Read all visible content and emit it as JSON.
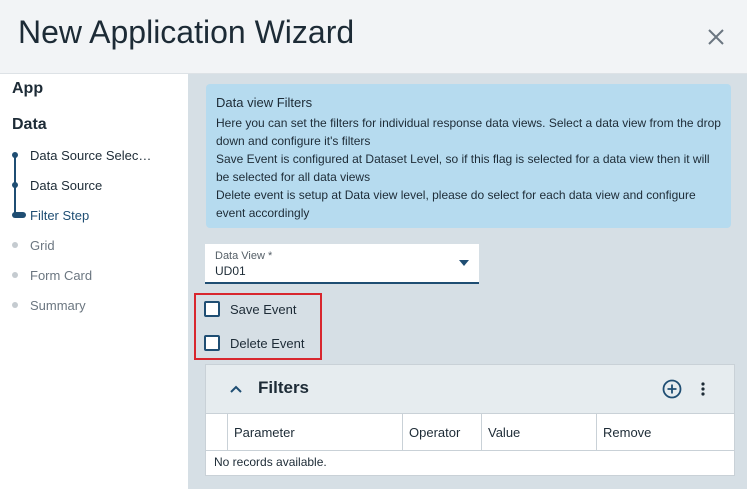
{
  "header": {
    "title": "New Application Wizard"
  },
  "sidebar": {
    "sections": [
      "App",
      "Data"
    ],
    "steps": [
      {
        "label": "Data Source Selec…",
        "state": "done"
      },
      {
        "label": "Data Source",
        "state": "done"
      },
      {
        "label": "Filter Step",
        "state": "active"
      },
      {
        "label": "Grid",
        "state": "pending"
      },
      {
        "label": "Form Card",
        "state": "pending"
      },
      {
        "label": "Summary",
        "state": "pending"
      }
    ]
  },
  "info": {
    "heading": "Data view Filters",
    "lines": [
      "Here you can set the filters for individual response data views. Select a data view from the drop down and configure it's filters",
      "Save Event is configured at Dataset Level, so if this flag is selected for a data view then it will be selected for all data views",
      "Delete event is setup at Data view level, please do select for each data view and configure event accordingly"
    ]
  },
  "dataview": {
    "label": "Data View *",
    "value": "UD01"
  },
  "checkboxes": [
    {
      "label": "Save Event",
      "checked": false
    },
    {
      "label": "Delete Event",
      "checked": false
    }
  ],
  "filters": {
    "title": "Filters",
    "columns": [
      "Parameter",
      "Operator",
      "Value",
      "Remove"
    ],
    "empty_text": "No records available."
  },
  "colors": {
    "accent": "#1f4e73",
    "info_bg": "#b6dbef",
    "highlight": "#d8262e",
    "panel_bg": "#d6dfe5"
  }
}
